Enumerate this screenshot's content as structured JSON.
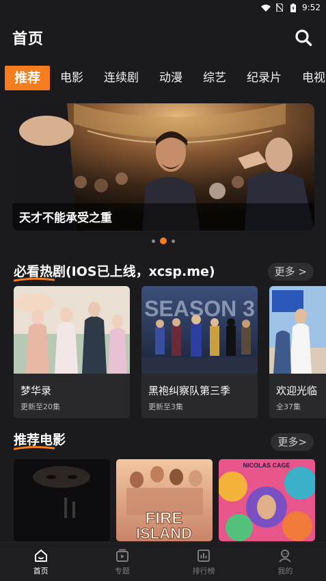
{
  "status": {
    "time": "9:52"
  },
  "header": {
    "title": "首页"
  },
  "tabs": [
    {
      "label": "推荐",
      "active": true
    },
    {
      "label": "电影"
    },
    {
      "label": "连续剧"
    },
    {
      "label": "动漫"
    },
    {
      "label": "综艺"
    },
    {
      "label": "纪录片"
    },
    {
      "label": "电视"
    }
  ],
  "banner": {
    "caption": "天才不能承受之重",
    "slide_count": 3,
    "active_slide": 2
  },
  "hot_section": {
    "title": "必看热剧(IOS已上线，xcsp.me)",
    "more": "更多 >",
    "items": [
      {
        "name": "梦华录",
        "sub": "更新至20集"
      },
      {
        "name": "黑袍纠察队第三季",
        "sub": "更新至3集"
      },
      {
        "name": "欢迎光临",
        "sub": "全37集"
      }
    ]
  },
  "movie_section": {
    "title": "推荐电影",
    "more": "更多>",
    "poster_texts": {
      "fire_island_top": "FIRE",
      "fire_island_bottom": "ISLAND",
      "cage": "NICOLAS CAGE"
    }
  },
  "bottom_nav": [
    {
      "label": "首页",
      "icon": "home-icon",
      "active": true
    },
    {
      "label": "专题",
      "icon": "topic-icon"
    },
    {
      "label": "排行榜",
      "icon": "ranking-icon"
    },
    {
      "label": "我的",
      "icon": "profile-icon"
    }
  ],
  "colors": {
    "accent": "#f57c1f",
    "background": "#1b1b1d",
    "card": "#29292c"
  }
}
